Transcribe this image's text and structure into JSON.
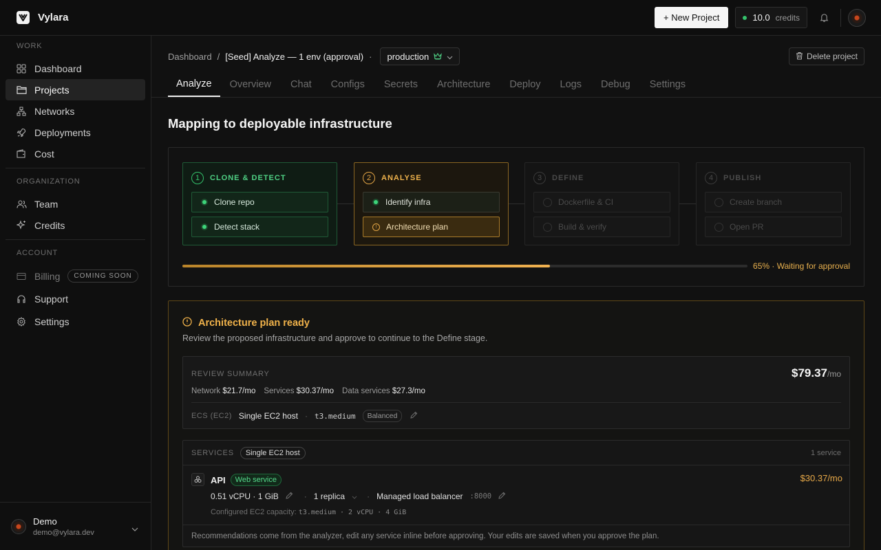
{
  "app": {
    "name": "Vylara"
  },
  "topbar": {
    "new_project_label": "+ New Project",
    "credits_value": "10.0",
    "credits_unit": "credits"
  },
  "sidebar": {
    "sections": {
      "work": "WORK",
      "organization": "ORGANIZATION",
      "account": "ACCOUNT"
    },
    "work_items": [
      {
        "label": "Dashboard",
        "icon": "grid-icon"
      },
      {
        "label": "Projects",
        "icon": "folder-icon"
      },
      {
        "label": "Networks",
        "icon": "network-icon"
      },
      {
        "label": "Deployments",
        "icon": "rocket-icon"
      },
      {
        "label": "Cost",
        "icon": "wallet-icon"
      }
    ],
    "org_items": [
      {
        "label": "Team",
        "icon": "users-icon"
      },
      {
        "label": "Credits",
        "icon": "sparkle-icon"
      }
    ],
    "account_items": [
      {
        "label": "Billing",
        "icon": "card-icon",
        "badge": "COMING SOON"
      },
      {
        "label": "Support",
        "icon": "headset-icon"
      },
      {
        "label": "Settings",
        "icon": "gear-icon"
      }
    ],
    "user": {
      "name": "Demo",
      "email": "demo@vylara.dev"
    }
  },
  "breadcrumb": {
    "root": "Dashboard",
    "separator": "/",
    "current": "[Seed] Analyze — 1 env (approval)",
    "dot": "·",
    "environment": "production"
  },
  "delete_label": "Delete project",
  "tabs": [
    "Analyze",
    "Overview",
    "Chat",
    "Configs",
    "Secrets",
    "Architecture",
    "Deploy",
    "Logs",
    "Debug",
    "Settings"
  ],
  "page_title": "Mapping to deployable infrastructure",
  "pipeline": {
    "stages": [
      {
        "num": "1",
        "name": "CLONE & DETECT",
        "status": "done",
        "tasks": [
          "Clone repo",
          "Detect stack"
        ]
      },
      {
        "num": "2",
        "name": "ANALYSE",
        "status": "current",
        "tasks": [
          "Identify infra",
          "Architecture plan"
        ]
      },
      {
        "num": "3",
        "name": "DEFINE",
        "status": "todo",
        "tasks": [
          "Dockerfile & CI",
          "Build & verify"
        ]
      },
      {
        "num": "4",
        "name": "PUBLISH",
        "status": "todo",
        "tasks": [
          "Create branch",
          "Open PR"
        ]
      }
    ],
    "progress": 0.65,
    "progress_text": "65% · Waiting for approval"
  },
  "approval": {
    "title": "Architecture plan ready",
    "subtitle": "Review the proposed infrastructure and approve to continue to the Define stage.",
    "summary": {
      "label": "REVIEW SUMMARY",
      "total": "$79.37",
      "per": "/mo",
      "network_k": "Network",
      "network_v": "$21.7/mo",
      "services_k": "Services",
      "services_v": "$30.37/mo",
      "data_k": "Data services",
      "data_v": "$27.3/mo",
      "compute_k": "ECS (EC2)",
      "compute_v": "Single EC2 host",
      "instance": "t3.medium",
      "profile": "Balanced"
    },
    "services": {
      "label": "SERVICES",
      "mode": "Single EC2 host",
      "count": "1 service",
      "items": [
        {
          "name": "API",
          "type": "Web service",
          "price": "$30.37/mo",
          "resources": "0.51 vCPU · 1 GiB",
          "replicas": "1 replica",
          "lb": "Managed load balancer",
          "port": ":8000",
          "capacity_label": "Configured EC2 capacity:",
          "capacity_value": "t3.medium · 2 vCPU · 4 GiB"
        }
      ],
      "footer": "Recommendations come from the analyzer, edit any service inline before approving. Your edits are saved when you approve the plan."
    }
  },
  "colors": {
    "accent_amber": "#f0b24a",
    "success_green": "#34c26b"
  }
}
